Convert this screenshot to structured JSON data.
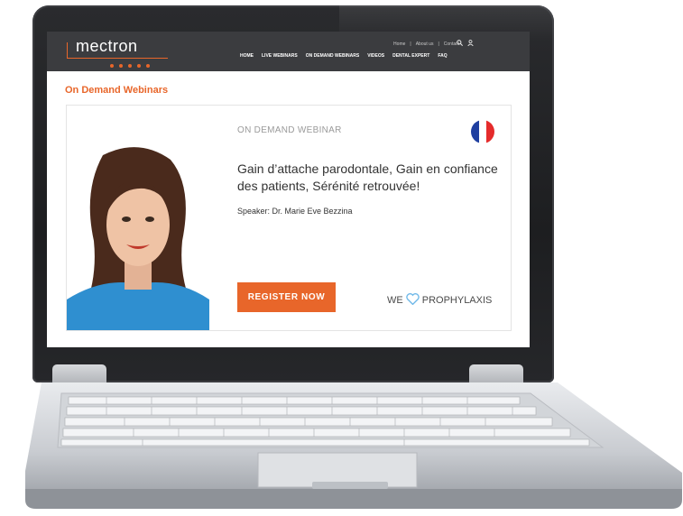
{
  "site": {
    "logo": "mectron",
    "util_links": [
      "Home",
      "|",
      "About us",
      "|",
      "Contact"
    ],
    "nav": [
      "HOME",
      "LIVE WEBINARS",
      "ON DEMAND WEBINARS",
      "VIDEOS",
      "DENTAL EXPERT",
      "FAQ"
    ]
  },
  "page": {
    "section_title": "On Demand Webinars"
  },
  "card": {
    "eyebrow": "ON DEMAND WEBINAR",
    "headline": "Gain d’attache parodontale, Gain en confiance des patients, Sérénité retrouvée!",
    "speaker": "Speaker: Dr. Marie Eve Bezzina",
    "cta": "REGISTER NOW",
    "tagline_pre": "WE",
    "tagline_post": "PROPHYLAXIS",
    "flag_colors": [
      "#1f3fa0",
      "#ffffff",
      "#e52b2b"
    ]
  },
  "colors": {
    "accent": "#e8662a",
    "header": "#3b3c3f"
  }
}
